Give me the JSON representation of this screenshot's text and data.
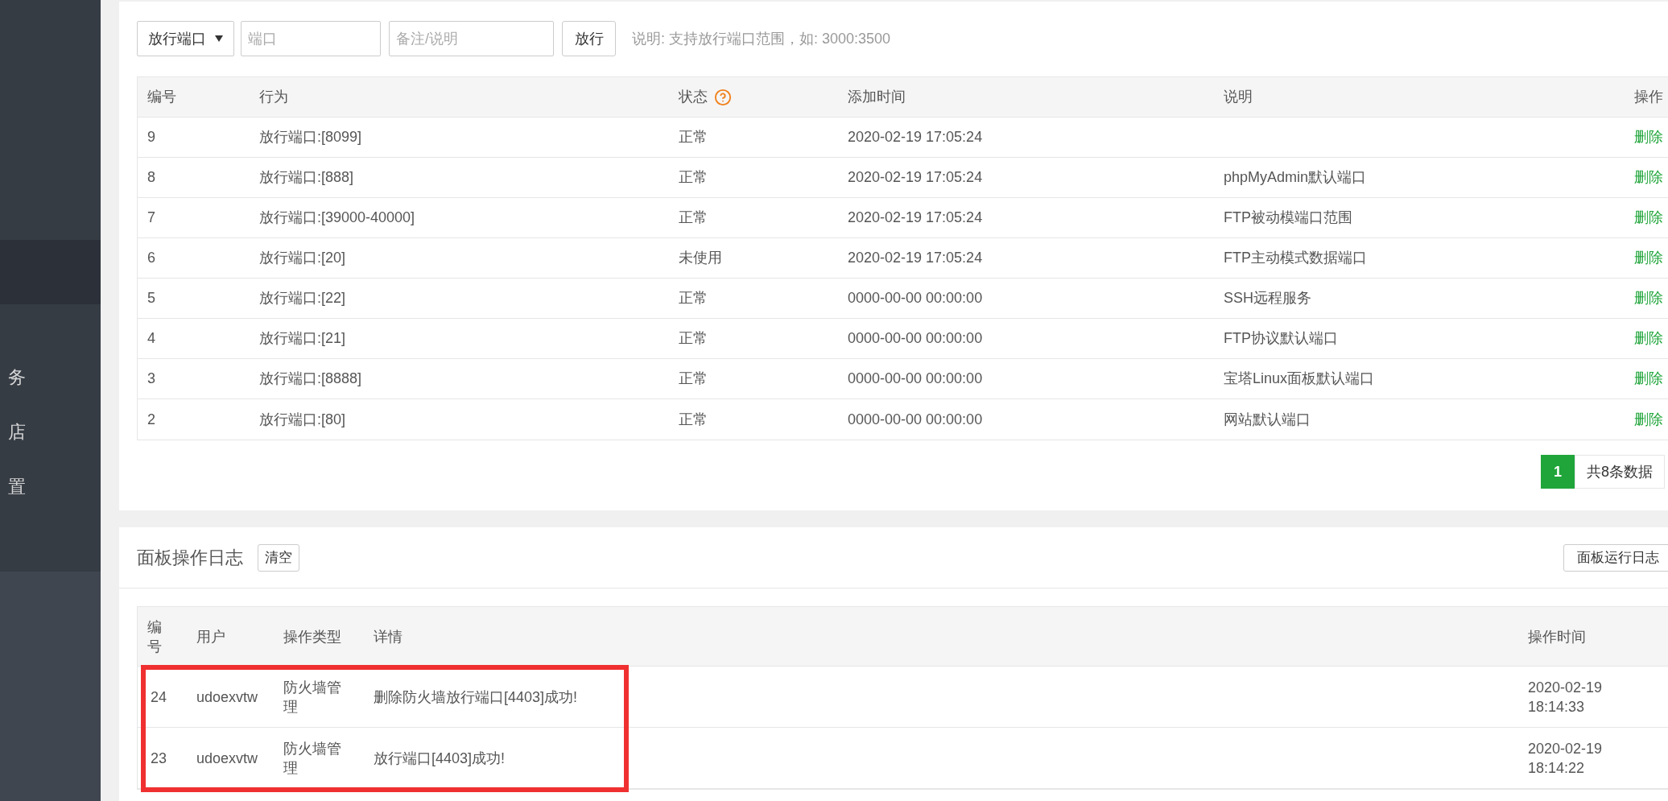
{
  "sidebar": {
    "items": [
      {
        "selected": true
      },
      {
        "label": "务",
        "selected": false
      },
      {
        "label": "店",
        "selected": false
      },
      {
        "label": "置",
        "selected": false
      }
    ]
  },
  "firewall": {
    "port_select": {
      "value": "放行端口"
    },
    "port_field": {
      "placeholder": "端口"
    },
    "note_field": {
      "placeholder": "备注/说明"
    },
    "submit_button": "放行",
    "hint": "说明: 支持放行端口范围，如: 3000:3500",
    "table": {
      "columns": [
        {
          "label": "编号"
        },
        {
          "label": "行为"
        },
        {
          "label": "状态",
          "help": true
        },
        {
          "label": "添加时间"
        },
        {
          "label": "说明"
        },
        {
          "label": "操作"
        }
      ],
      "rows": [
        {
          "id": "9",
          "action": "放行端口:[8099]",
          "status": "正常",
          "added": "2020-02-19 17:05:24",
          "op": "删除"
        },
        {
          "id": "8",
          "action": "放行端口:[888]",
          "status": "正常",
          "added": "2020-02-19 17:05:24",
          "note": "phpMyAdmin默认端口",
          "op": "删除"
        },
        {
          "id": "7",
          "action": "放行端口:[39000-40000]",
          "status": "正常",
          "added": "2020-02-19 17:05:24",
          "note": "FTP被动模端口范围",
          "op": "删除"
        },
        {
          "id": "6",
          "action": "放行端口:[20]",
          "status": "未使用",
          "added": "2020-02-19 17:05:24",
          "note": "FTP主动模式数据端口",
          "op": "删除"
        },
        {
          "id": "5",
          "action": "放行端口:[22]",
          "status": "正常",
          "added": "0000-00-00 00:00:00",
          "note": "SSH远程服务",
          "op": "删除"
        },
        {
          "id": "4",
          "action": "放行端口:[21]",
          "status": "正常",
          "added": "0000-00-00 00:00:00",
          "note": "FTP协议默认端口",
          "op": "删除"
        },
        {
          "id": "3",
          "action": "放行端口:[8888]",
          "status": "正常",
          "added": "0000-00-00 00:00:00",
          "note": "宝塔Linux面板默认端口",
          "op": "删除"
        },
        {
          "id": "2",
          "action": "放行端口:[80]",
          "status": "正常",
          "added": "0000-00-00 00:00:00",
          "note": "网站默认端口",
          "op": "删除"
        }
      ]
    },
    "pagination": {
      "pages": [
        {
          "label": "1",
          "selected": true
        }
      ],
      "total": "共8条数据"
    }
  },
  "logs": {
    "title": "面板操作日志",
    "clear_button": "清空",
    "run_log_button": "面板运行日志",
    "table": {
      "columns": [
        "编号",
        "用户",
        "操作类型",
        "详情",
        "操作时间"
      ],
      "rows": [
        {
          "id": "24",
          "user": "udoexvtw",
          "type": "防火墙管理",
          "detail": "删除防火墙放行端口[4403]成功!",
          "time": "2020-02-19 18:14:33",
          "highlighted": true
        },
        {
          "id": "23",
          "user": "udoexvtw",
          "type": "防火墙管理",
          "detail": "放行端口[4403]成功!",
          "time": "2020-02-19 18:14:22",
          "highlighted": true
        }
      ]
    }
  }
}
